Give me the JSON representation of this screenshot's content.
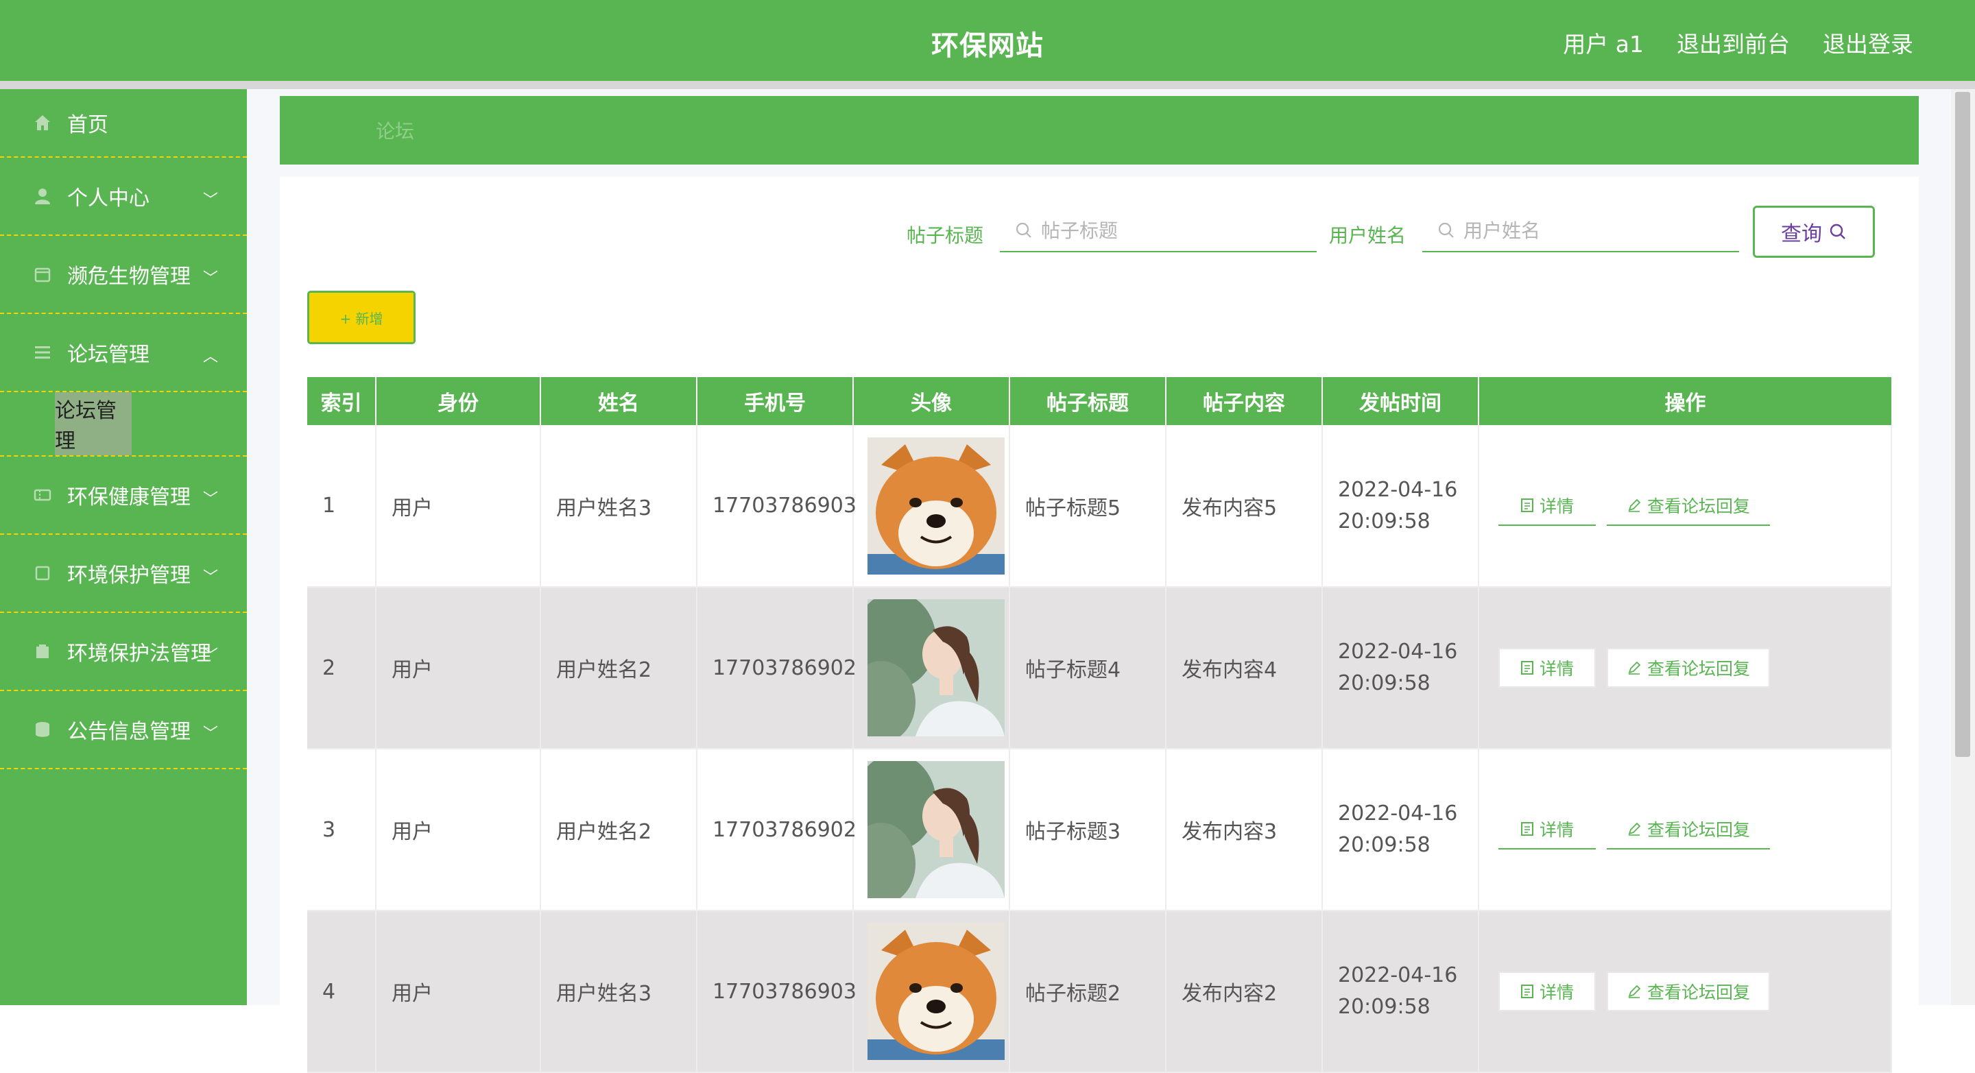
{
  "header": {
    "title": "环保网站",
    "user": "用户 a1",
    "to_front": "退出到前台",
    "logout": "退出登录"
  },
  "sidebar": {
    "items": [
      {
        "label": "首页",
        "icon": "home-icon"
      },
      {
        "label": "个人中心",
        "icon": "user-icon"
      },
      {
        "label": "濒危生物管理",
        "icon": "calendar-icon"
      },
      {
        "label": "论坛管理",
        "icon": "list-icon",
        "expanded": true,
        "sub": "论坛管理"
      },
      {
        "label": "环保健康管理",
        "icon": "ticket-icon"
      },
      {
        "label": "环境保护管理",
        "icon": "box-icon"
      },
      {
        "label": "环境保护法管理",
        "icon": "building-icon"
      },
      {
        "label": "公告信息管理",
        "icon": "database-icon"
      }
    ]
  },
  "breadcrumb": "论坛",
  "search": {
    "title_label": "帖子标题",
    "title_placeholder": "帖子标题",
    "name_label": "用户姓名",
    "name_placeholder": "用户姓名",
    "query_label": "查询"
  },
  "add_label": "+ 新增",
  "table": {
    "headers": [
      "索引",
      "身份",
      "姓名",
      "手机号",
      "头像",
      "帖子标题",
      "帖子内容",
      "发帖时间",
      "操作"
    ],
    "rows": [
      {
        "index": "1",
        "role": "用户",
        "name": "用户姓名3",
        "phone": "17703786903",
        "avatar": "shiba-dog",
        "title": "帖子标题5",
        "content": "发布内容5",
        "time": "2022-04-16 20:09:58"
      },
      {
        "index": "2",
        "role": "用户",
        "name": "用户姓名2",
        "phone": "17703786902",
        "avatar": "girl-portrait",
        "title": "帖子标题4",
        "content": "发布内容4",
        "time": "2022-04-16 20:09:58"
      },
      {
        "index": "3",
        "role": "用户",
        "name": "用户姓名2",
        "phone": "17703786902",
        "avatar": "girl-portrait",
        "title": "帖子标题3",
        "content": "发布内容3",
        "time": "2022-04-16 20:09:58"
      },
      {
        "index": "4",
        "role": "用户",
        "name": "用户姓名3",
        "phone": "17703786903",
        "avatar": "shiba-dog",
        "title": "帖子标题2",
        "content": "发布内容2",
        "time": "2022-04-16 20:09:58"
      }
    ],
    "detail_label": "详情",
    "reply_label": "查看论坛回复"
  },
  "colors": {
    "primary": "#59b551",
    "accent_yellow": "#f5d300",
    "row_alt": "#e4e2e2"
  }
}
